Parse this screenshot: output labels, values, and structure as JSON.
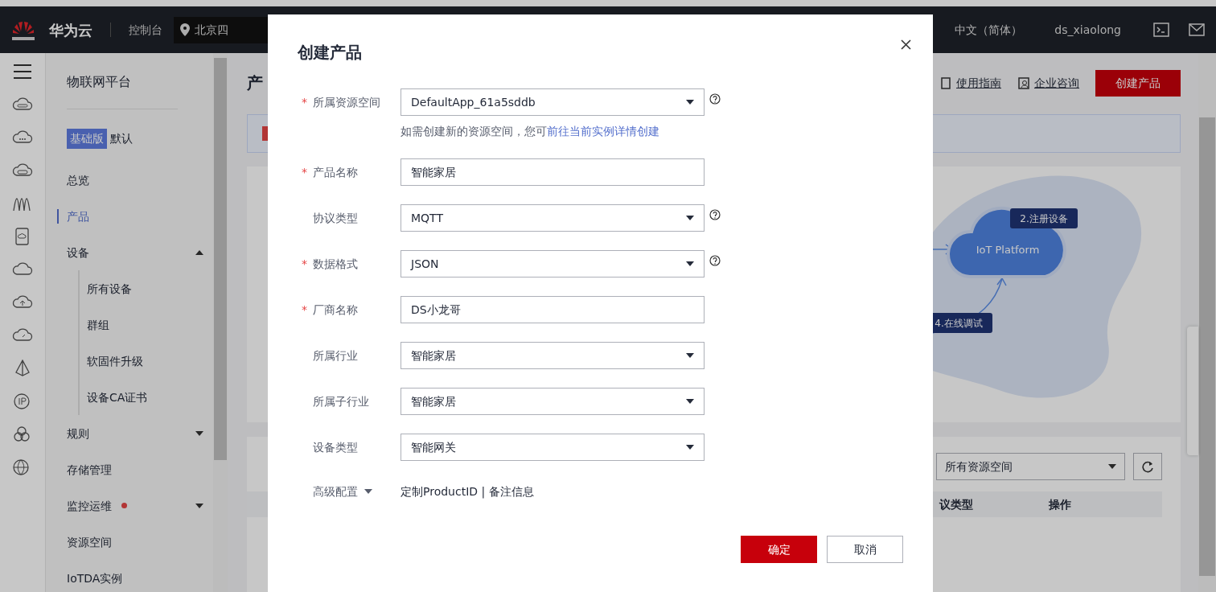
{
  "top_nav": {
    "brand": "华为云",
    "console": "控制台",
    "region": "北京四",
    "language": "中文（简体）",
    "user": "ds_xiaolong"
  },
  "sidebar": {
    "title": "物联网平台",
    "edition_badge": "基础版",
    "edition": "默认",
    "items": [
      {
        "label": "总览",
        "kind": "link",
        "selected": false,
        "alert": false
      },
      {
        "label": "产品",
        "kind": "link",
        "selected": true,
        "alert": false
      },
      {
        "label": "设备",
        "kind": "group",
        "expanded": true,
        "selected": false,
        "alert": false,
        "children": [
          {
            "label": "所有设备",
            "selected": false
          },
          {
            "label": "群组",
            "selected": false
          },
          {
            "label": "软固件升级",
            "selected": false
          },
          {
            "label": "设备CA证书",
            "selected": false
          }
        ]
      },
      {
        "label": "规则",
        "kind": "group",
        "expanded": false,
        "selected": false,
        "alert": false
      },
      {
        "label": "存储管理",
        "kind": "link",
        "selected": false,
        "alert": false
      },
      {
        "label": "监控运维",
        "kind": "group",
        "expanded": false,
        "selected": false,
        "alert": true
      },
      {
        "label": "资源空间",
        "kind": "link",
        "selected": false,
        "alert": false
      },
      {
        "label": "IoTDA实例",
        "kind": "link",
        "selected": false,
        "alert": false
      }
    ]
  },
  "page": {
    "title": "产",
    "links": [
      "使用指南",
      "企业咨询"
    ],
    "create_button": "创建产品",
    "diagram": {
      "center": "IoT Platform",
      "steps": [
        "2.注册设备",
        "4.在线调试"
      ]
    },
    "filter_select": "所有资源空间",
    "table_columns": [
      "议类型",
      "操作"
    ]
  },
  "dialog": {
    "title": "创建产品",
    "required_mark": "*",
    "fields": [
      {
        "label": "所属资源空间",
        "required": true,
        "kind": "select",
        "value": "DefaultApp_61a5sddb",
        "help": true,
        "hint": "如需创建新的资源空间，您可",
        "hint_link": "前往当前实例详情创建"
      },
      {
        "label": "产品名称",
        "required": true,
        "kind": "text",
        "value": "智能家居",
        "help": false
      },
      {
        "label": "协议类型",
        "required": false,
        "kind": "select",
        "value": "MQTT",
        "help": true
      },
      {
        "label": "数据格式",
        "required": true,
        "kind": "select",
        "value": "JSON",
        "help": true
      },
      {
        "label": "厂商名称",
        "required": true,
        "kind": "text",
        "value": "DS小龙哥",
        "help": false
      },
      {
        "label": "所属行业",
        "required": false,
        "kind": "select",
        "value": "智能家居",
        "help": false
      },
      {
        "label": "所属子行业",
        "required": false,
        "kind": "select",
        "value": "智能家居",
        "help": false
      },
      {
        "label": "设备类型",
        "required": false,
        "kind": "select",
        "value": "智能网关",
        "help": false
      }
    ],
    "advanced": {
      "label": "高级配置",
      "expanded": false,
      "options": "定制ProductID | 备注信息"
    },
    "buttons": [
      {
        "label": "确定",
        "kind": "primary"
      },
      {
        "label": "取消",
        "kind": "secondary"
      }
    ]
  }
}
